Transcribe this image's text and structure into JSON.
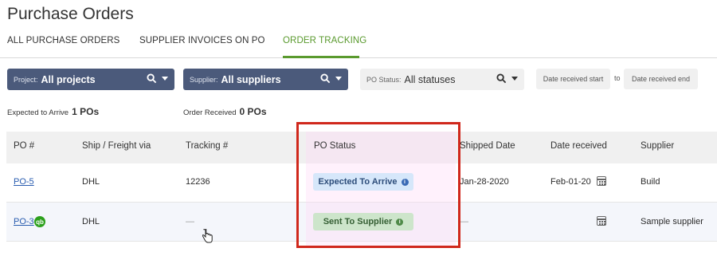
{
  "page": {
    "title": "Purchase Orders"
  },
  "tabs": [
    {
      "label": "ALL PURCHASE ORDERS",
      "active": false
    },
    {
      "label": "SUPPLIER INVOICES ON PO",
      "active": false
    },
    {
      "label": "ORDER TRACKING",
      "active": true
    }
  ],
  "filters": {
    "project": {
      "label": "Project:",
      "value": "All projects"
    },
    "supplier": {
      "label": "Supplier:",
      "value": "All suppliers"
    },
    "po_status": {
      "label": "PO Status:",
      "value": "All statuses"
    },
    "date_start_placeholder": "Date received start",
    "to_label": "to",
    "date_end_placeholder": "Date received end"
  },
  "summary": {
    "expected_label": "Expected to Arrive",
    "expected_value": "1 POs",
    "received_label": "Order Received",
    "received_value": "0 POs"
  },
  "table": {
    "columns": [
      "PO #",
      "Ship / Freight via",
      "Tracking #",
      "PO Status",
      "Shipped Date",
      "Date received",
      "Supplier"
    ],
    "rows": [
      {
        "po": "PO-5",
        "ship_via": "DHL",
        "tracking": "12236",
        "status": "Expected To Arrive",
        "shipped": "Jan-28-2020",
        "received": "Feb-01-20",
        "supplier": "Build",
        "qb_badge": false
      },
      {
        "po": "PO-3",
        "ship_via": "DHL",
        "tracking": "—",
        "status": "Sent To Supplier",
        "shipped": "—",
        "received": "",
        "supplier": "Sample supplier",
        "qb_badge": true,
        "qb_label": "qb"
      }
    ]
  },
  "colors": {
    "accent_green": "#5a9a2e",
    "filter_dark": "#4b5a7b",
    "status_blue": "#d6e7fa",
    "status_green": "#cde5cb",
    "highlight_red": "#d0281c"
  },
  "icons": [
    "search-icon",
    "caret-down-icon",
    "calendar-icon",
    "info-icon",
    "quickbooks-icon",
    "hand-cursor-icon"
  ]
}
